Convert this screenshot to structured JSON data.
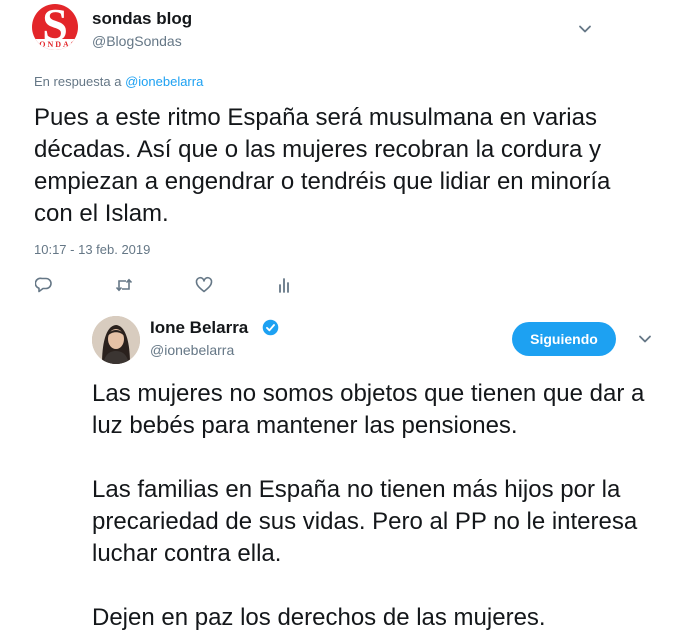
{
  "tweet1": {
    "author_name": "sondas blog",
    "author_handle": "@BlogSondas",
    "avatar_letter": "S",
    "avatar_caption": "SONDAS",
    "reply_prefix": "En respuesta a",
    "reply_mention": "@ionebelarra",
    "text": "Pues a este ritmo España será musulmana en varias décadas. Así que o las mujeres recobran la cordura y empiezan a engendrar o tendréis que lidiar en minoría con el Islam.",
    "timestamp": "10:17 - 13 feb. 2019"
  },
  "tweet2": {
    "author_name": "Ione Belarra",
    "author_handle": "@ionebelarra",
    "follow_label": "Siguiendo",
    "paragraphs": [
      "Las mujeres no somos objetos que tienen que dar a luz bebés para mantener las pensiones.",
      "Las familias en España no tienen más hijos por la precariedad de sus vidas. Pero al PP no le interesa luchar contra ella.",
      "Dejen en paz los derechos de las mujeres."
    ]
  },
  "icons": [
    "reply-icon",
    "retweet-icon",
    "like-icon",
    "analytics-icon",
    "chevron-down-icon",
    "verified-icon"
  ],
  "colors": {
    "accent": "#1da1f2",
    "muted": "#657786",
    "brand_red": "#e3262a",
    "text": "#14171a"
  }
}
